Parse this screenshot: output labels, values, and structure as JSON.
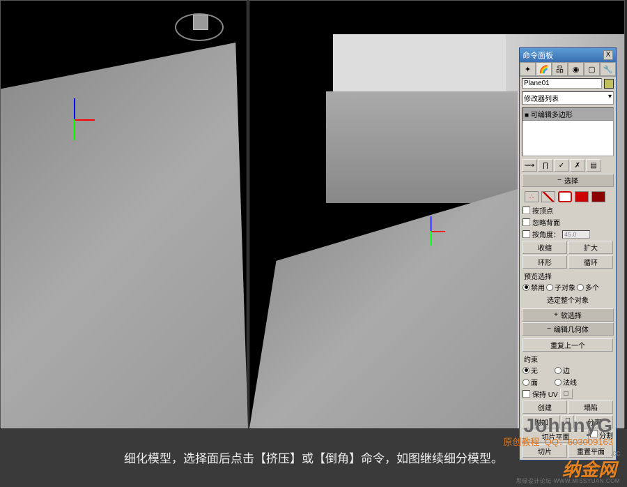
{
  "panel": {
    "title": "命令面板",
    "close": "X",
    "object_name": "Plane01",
    "modifier_dropdown": "修改器列表",
    "stack_item": "■ 可编辑多边形",
    "rollouts": {
      "selection": {
        "header": "选择",
        "by_vertex": "按顶点",
        "ignore_backfacing": "忽略背面",
        "by_angle": "按角度：",
        "angle_value": "45.0",
        "shrink": "收缩",
        "grow": "扩大",
        "ring": "环形",
        "loop": "循环",
        "preview_label": "预览选择",
        "preview_off": "禁用",
        "preview_subobj": "子对象",
        "preview_multi": "多个",
        "select_whole": "选定整个对象"
      },
      "soft_selection": {
        "header": "软选择"
      },
      "edit_geometry": {
        "header": "编辑几何体",
        "repeat_last": "重复上一个",
        "constraints_label": "约束",
        "constraint_none": "无",
        "constraint_edge": "边",
        "constraint_face": "面",
        "constraint_normal": "法线",
        "preserve_uv": "保持 UV",
        "preserve_uv_settings": "□",
        "create": "创建",
        "collapse": "塌陷",
        "attach": "附加",
        "attach_settings": "□",
        "detach": "分离",
        "slice_plane": "切片平面",
        "split": "分割",
        "slice": "切片",
        "reset_plane": "重置平面"
      }
    }
  },
  "caption": "细化模型，选择面后点击【挤压】或【倒角】命令，如图继续细分模型。",
  "watermark": {
    "name": "JohnnyG",
    "subtitle": "原创教程",
    "qq": "QQ：603009163",
    "logo": "纳金网",
    "cc": ".cc",
    "url": "思缘设计论坛·WWW.MISSYUAN.COM"
  }
}
